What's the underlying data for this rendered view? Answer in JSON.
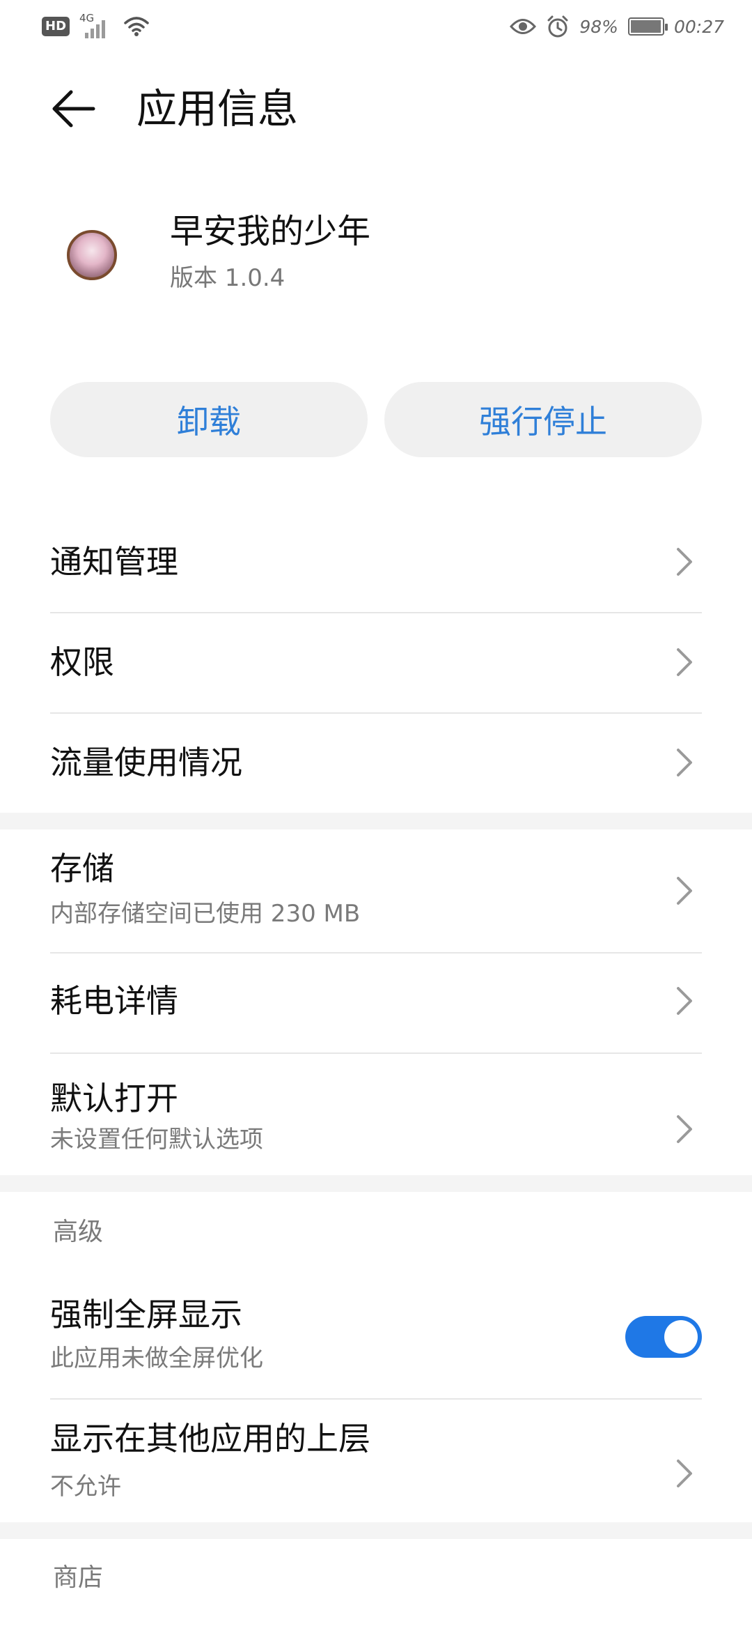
{
  "status_bar": {
    "hd": "HD",
    "network": "4G",
    "battery_percent": "98%",
    "battery_level": 0.98,
    "time": "00:27",
    "icons": [
      "eye-icon",
      "alarm-icon",
      "wifi-icon",
      "signal-icon",
      "battery-icon"
    ]
  },
  "header": {
    "title": "应用信息"
  },
  "app": {
    "name": "早安我的少年",
    "version": "版本 1.0.4"
  },
  "actions": {
    "uninstall": "卸载",
    "force_stop": "强行停止"
  },
  "rows": {
    "notifications": "通知管理",
    "permissions": "权限",
    "data_usage": "流量使用情况",
    "storage": {
      "label": "存储",
      "sub": "内部存储空间已使用 230 MB"
    },
    "battery": "耗电详情",
    "open_default": {
      "label": "默认打开",
      "sub": "未设置任何默认选项"
    }
  },
  "advanced": {
    "section": "高级",
    "fullscreen": {
      "label": "强制全屏显示",
      "sub": "此应用未做全屏优化",
      "enabled": true
    },
    "overlay": {
      "label": "显示在其他应用的上层",
      "sub": "不允许"
    }
  },
  "store": {
    "section": "商店"
  },
  "colors": {
    "accent": "#1f78e6",
    "button_text": "#2f7fd8",
    "button_bg": "#f0f0f0"
  }
}
